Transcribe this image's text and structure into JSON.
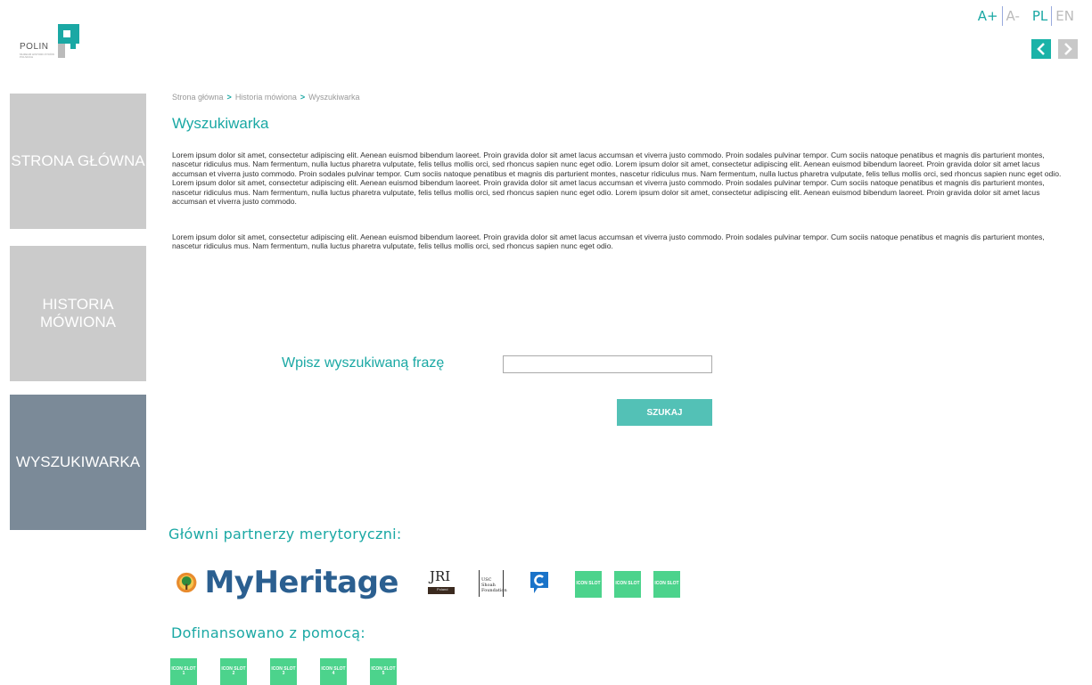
{
  "logo": {
    "text": "POLIN",
    "subtext": "MUZEUM HISTORII ŻYDÓW POLSKICH"
  },
  "top_controls": {
    "font_increase": "A+",
    "font_decrease": "A-",
    "lang_pl": "PL",
    "lang_en": "EN"
  },
  "sidebar": {
    "items": [
      {
        "label": "STRONA GŁÓWNA"
      },
      {
        "label": "HISTORIA MÓWIONA"
      },
      {
        "label": "WYSZUKIWARKA"
      }
    ]
  },
  "breadcrumb": {
    "items": [
      "Strona główna",
      "Historia mówiona",
      "Wyszukiwarka"
    ],
    "separator": ">"
  },
  "main": {
    "title": "Wyszukiwarka",
    "paragraph_1": "Lorem ipsum dolor sit amet, consectetur adipiscing elit. Aenean euismod bibendum laoreet. Proin gravida dolor sit amet lacus accumsan et viverra justo commodo. Proin sodales pulvinar tempor. Cum sociis natoque penatibus et magnis dis parturient montes, nascetur ridiculus mus. Nam fermentum, nulla luctus pharetra vulputate, felis tellus mollis orci, sed rhoncus sapien nunc eget odio. Lorem ipsum dolor sit amet, consectetur adipiscing elit. Aenean euismod bibendum laoreet. Proin gravida dolor sit amet lacus accumsan et viverra justo commodo. Proin sodales pulvinar tempor. Cum sociis natoque penatibus et magnis dis parturient montes, nascetur ridiculus mus. Nam fermentum, nulla luctus pharetra vulputate, felis tellus mollis orci, sed rhoncus sapien nunc eget odio. Lorem ipsum dolor sit amet, consectetur adipiscing elit. Aenean euismod bibendum laoreet. Proin gravida dolor sit amet lacus accumsan et viverra justo commodo. Proin sodales pulvinar tempor. Cum sociis natoque penatibus et magnis dis parturient montes, nascetur ridiculus mus. Nam fermentum, nulla luctus pharetra vulputate, felis tellus mollis orci, sed rhoncus sapien nunc eget odio. Lorem ipsum dolor sit amet, consectetur adipiscing elit. Aenean euismod bibendum laoreet. Proin gravida dolor sit amet lacus accumsan et viverra justo commodo.",
    "paragraph_2": "Lorem ipsum dolor sit amet, consectetur adipiscing elit. Aenean euismod bibendum laoreet. Proin gravida dolor sit amet lacus accumsan et viverra justo commodo. Proin sodales pulvinar tempor. Cum sociis natoque penatibus et magnis dis parturient montes, nascetur ridiculus mus. Nam fermentum, nulla luctus pharetra vulputate, felis tellus mollis orci, sed rhoncus sapien nunc eget odio."
  },
  "search": {
    "label": "Wpisz wyszukiwaną frazę",
    "value": "",
    "button_label": "SZUKAJ"
  },
  "partners": {
    "title": "Główni partnerzy merytoryczni:",
    "myheritage": "MyHeritage",
    "jri_text": "JRI",
    "jri_sub": "Poland",
    "usc_text": "USC Shoah Foundation",
    "slots": [
      "ICON SLOT",
      "ICON SLOT",
      "ICON SLOT"
    ]
  },
  "funding": {
    "title": "Dofinansowano z pomocą:",
    "slots": [
      "ICON SLOT 1",
      "ICON SLOT 2",
      "ICON SLOT 3",
      "ICON SLOT 4",
      "ICON SLOT 5"
    ]
  },
  "colors": {
    "accent": "#1aa8a4",
    "button": "#53c1b6",
    "sidebar_inactive": "#cbcbcb",
    "sidebar_active": "#7b8a98",
    "icon_slot": "#4cd38c"
  }
}
